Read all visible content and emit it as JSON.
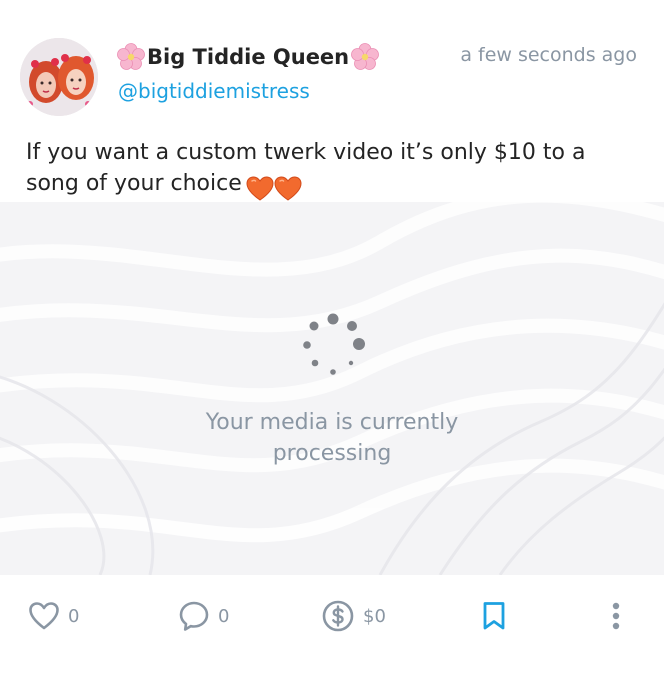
{
  "post": {
    "display_name": "Big Tiddie Queen",
    "handle": "@bigtiddiemistress",
    "timestamp": "a few seconds ago",
    "text": "If you want a custom twerk video it’s only $10 to a song of your choice",
    "name_decoration_icon": "cherry-blossom-emoji",
    "text_emoji_icon": "orange-heart-emoji"
  },
  "media": {
    "status_line1": "Your media is currently",
    "status_line2": "processing",
    "spinner_icon": "loading-dots-spinner"
  },
  "actions": {
    "likes": "0",
    "comments": "0",
    "tips": "$0",
    "like_icon": "heart-outline-icon",
    "comment_icon": "speech-bubble-icon",
    "tip_icon": "dollar-circle-icon",
    "bookmark_icon": "bookmark-icon",
    "more_icon": "vertical-ellipsis-icon"
  },
  "colors": {
    "accent": "#1da1e0",
    "text": "#242424",
    "muted": "#8a96a3",
    "media_bg": "#f3f3f5"
  }
}
